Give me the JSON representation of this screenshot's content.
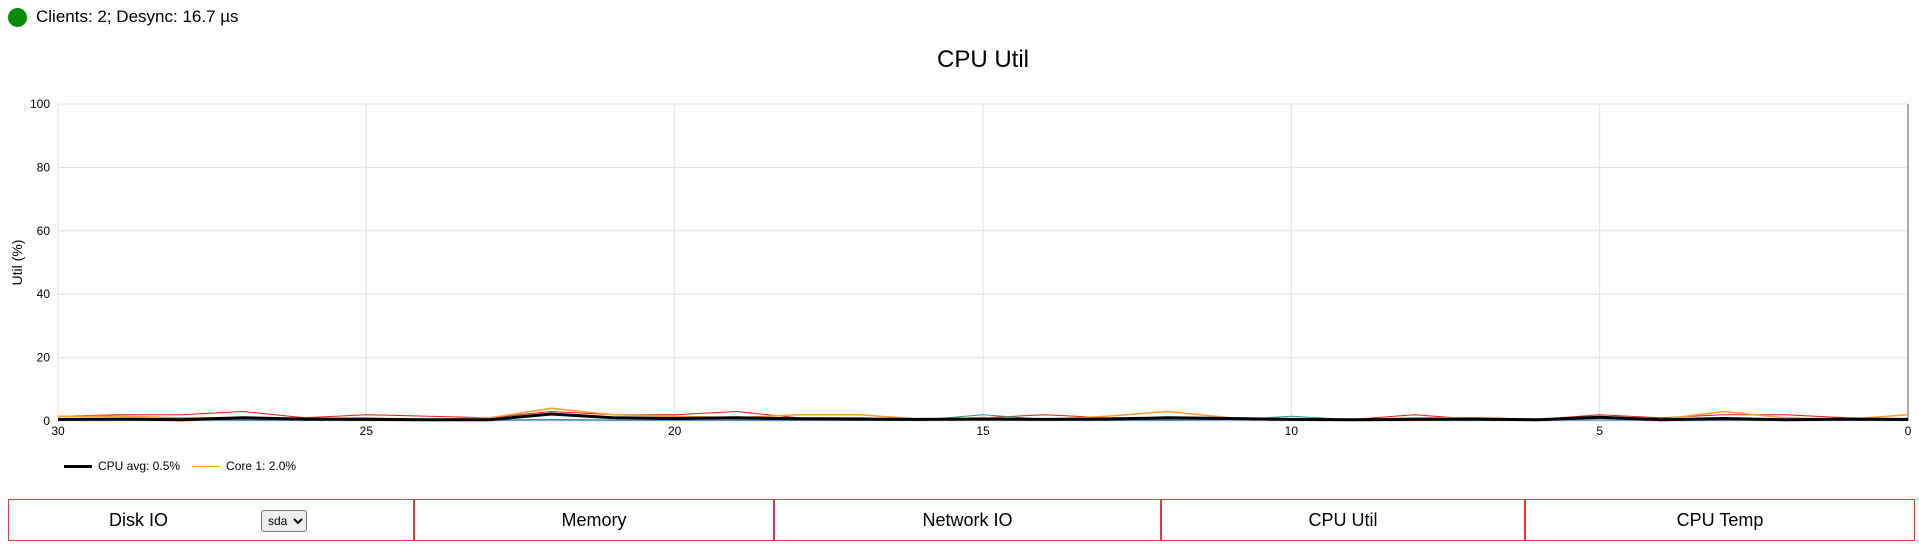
{
  "status": {
    "text": "Clients: 2; Desync: 16.7 µs",
    "indicator_color": "#0a8a0a"
  },
  "chart_data": {
    "type": "line",
    "title": "CPU Util",
    "ylabel": "Util (%)",
    "xlabel": "",
    "xlim": [
      30,
      0
    ],
    "ylim": [
      0,
      100
    ],
    "x_ticks": [
      30,
      25,
      20,
      15,
      10,
      5,
      0
    ],
    "y_ticks": [
      0,
      20,
      40,
      60,
      80,
      100
    ],
    "grid": true,
    "legend_position": "bottom-left",
    "x": [
      30,
      29,
      28,
      27,
      26,
      25,
      24,
      23,
      22,
      21,
      20,
      19,
      18,
      17,
      16,
      15,
      14,
      13,
      12,
      11,
      10,
      9,
      8,
      7,
      6,
      5,
      4,
      3,
      2,
      1,
      0
    ],
    "series": [
      {
        "name": "CPU avg: 0.5%",
        "color": "#000000",
        "width": 3,
        "in_legend": true,
        "values": [
          0.5,
          0.6,
          0.4,
          1.0,
          0.6,
          0.5,
          0.4,
          0.4,
          2.2,
          1.0,
          0.8,
          1.0,
          0.7,
          0.6,
          0.5,
          0.6,
          0.5,
          0.6,
          1.0,
          0.8,
          0.5,
          0.4,
          0.5,
          0.6,
          0.4,
          1.2,
          0.4,
          0.8,
          0.4,
          0.6,
          0.5
        ]
      },
      {
        "name": "Core 1: 2.0%",
        "color": "#ff9a2f",
        "width": 1.5,
        "in_legend": true,
        "values": [
          1.5,
          1.5,
          1.0,
          1.0,
          0.8,
          1.0,
          0.5,
          1.0,
          4.0,
          2.0,
          1.5,
          1.0,
          2.0,
          2.0,
          0.5,
          1.0,
          0.5,
          1.5,
          3.0,
          1.0,
          0.5,
          0.5,
          1.0,
          1.0,
          0.5,
          1.0,
          0.5,
          3.0,
          1.0,
          0.5,
          2.0
        ]
      },
      {
        "name": "",
        "color": "#e41a1c",
        "width": 1,
        "in_legend": false,
        "values": [
          1.5,
          2.0,
          2.0,
          3.0,
          1.0,
          2.0,
          1.5,
          1.0,
          3.0,
          2.0,
          2.0,
          3.0,
          1.0,
          1.0,
          0.5,
          1.0,
          2.0,
          1.0,
          1.0,
          1.0,
          0.5,
          0.5,
          2.0,
          0.5,
          0.5,
          2.0,
          1.0,
          2.0,
          2.0,
          1.0,
          0.5
        ]
      },
      {
        "name": "",
        "color": "#1f9e89",
        "width": 1,
        "in_legend": false,
        "values": [
          0.3,
          0.3,
          0.2,
          0.4,
          0.3,
          0.2,
          0.3,
          0.3,
          0.5,
          0.3,
          0.2,
          0.3,
          0.3,
          0.2,
          0.3,
          2.0,
          0.5,
          0.3,
          0.4,
          0.3,
          1.5,
          0.4,
          0.3,
          0.2,
          0.3,
          0.4,
          0.3,
          0.2,
          0.3,
          0.3,
          0.2
        ]
      },
      {
        "name": "",
        "color": "#4a7fd0",
        "width": 1,
        "in_legend": false,
        "values": [
          0.2,
          0.2,
          0.3,
          0.2,
          0.2,
          0.3,
          0.2,
          0.2,
          0.3,
          0.2,
          0.3,
          0.2,
          0.2,
          0.3,
          0.2,
          1.2,
          0.3,
          0.2,
          0.2,
          0.3,
          0.2,
          0.2,
          0.3,
          0.2,
          0.2,
          0.3,
          0.2,
          0.2,
          0.3,
          0.2,
          0.2
        ]
      }
    ]
  },
  "tabs": [
    {
      "label": "Disk IO"
    },
    {
      "label": "Memory"
    },
    {
      "label": "Network IO"
    },
    {
      "label": "CPU Util"
    },
    {
      "label": "CPU Temp"
    }
  ],
  "disk_select": {
    "value": "sda",
    "options": [
      "sda"
    ]
  }
}
